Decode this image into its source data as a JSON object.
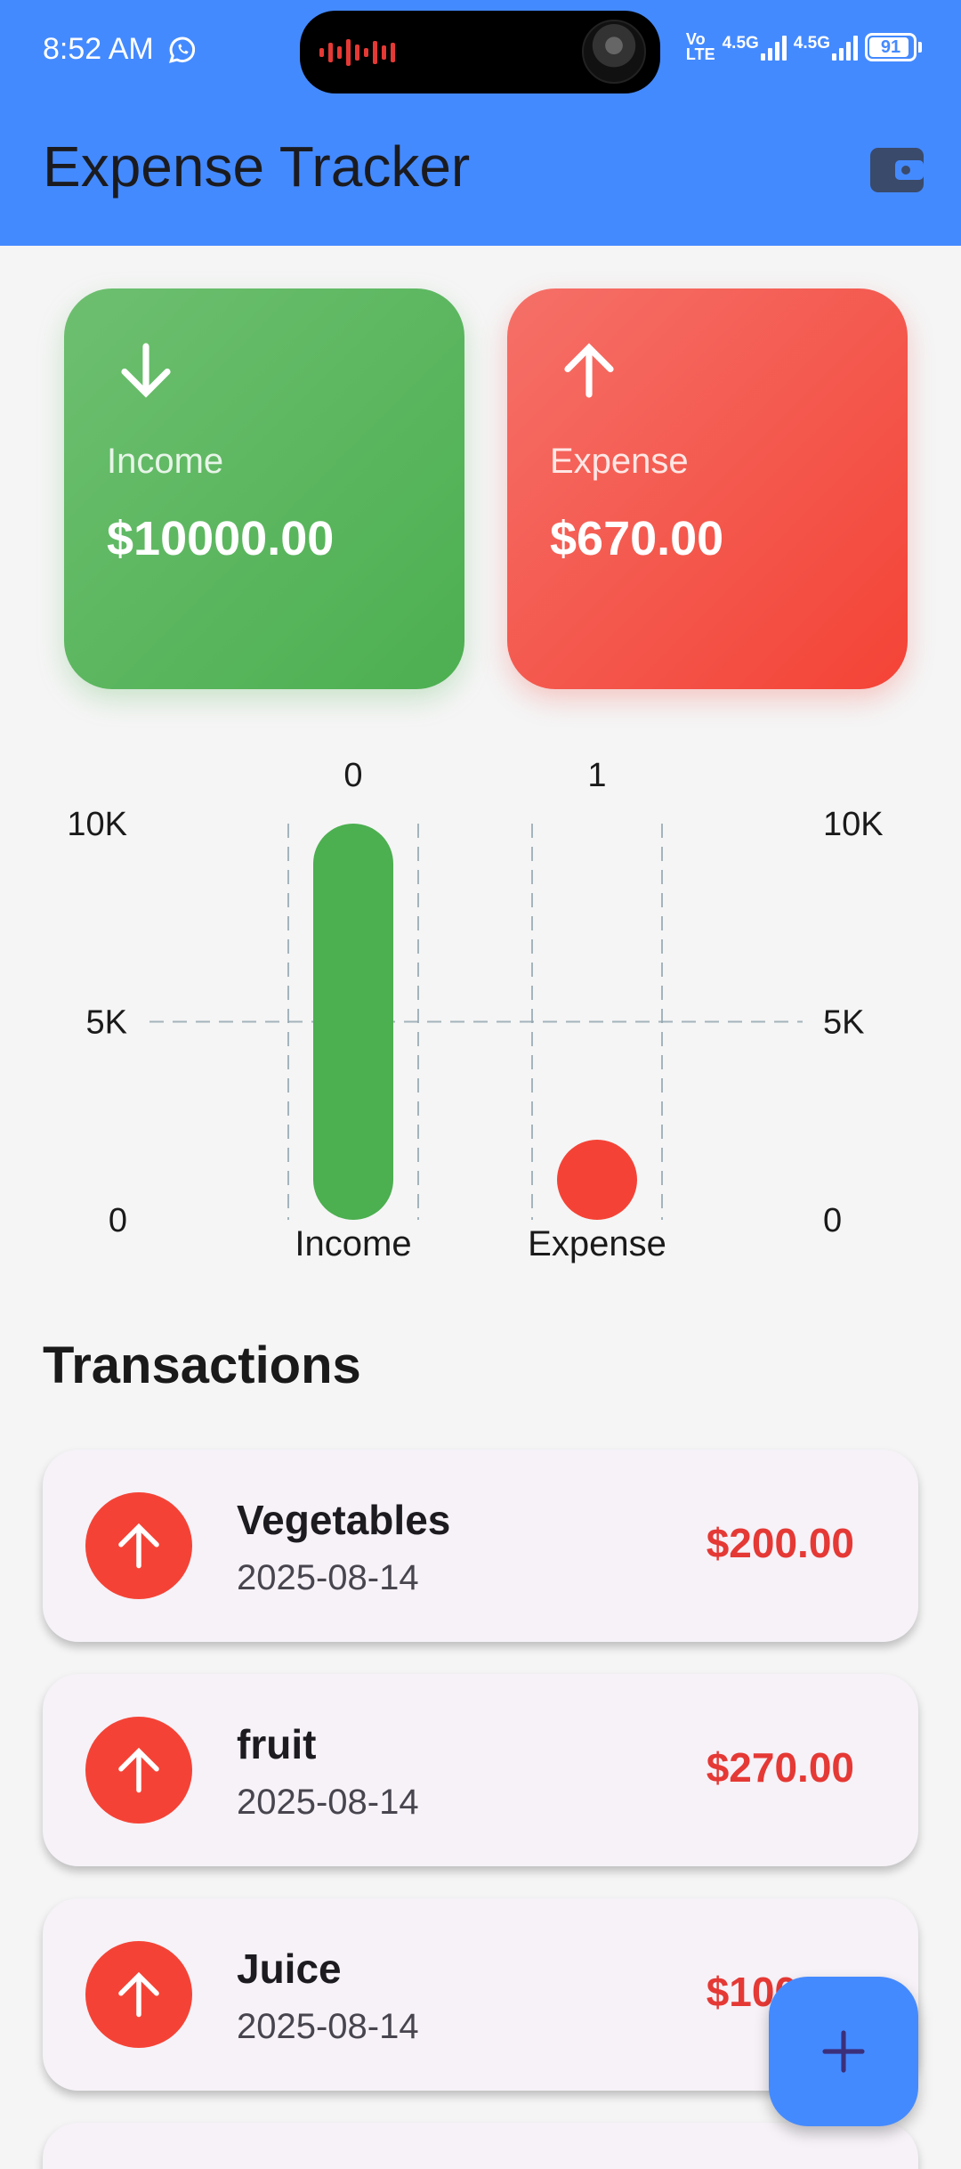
{
  "status_bar": {
    "time": "8:52 AM",
    "volte_top": "Vo",
    "volte_bottom": "LTE",
    "network1": "4.5G",
    "network2": "4.5G",
    "battery": "91",
    "battery_level": 0.91
  },
  "app_bar": {
    "title": "Expense Tracker",
    "action_icon": "wallet-icon"
  },
  "summary": {
    "income": {
      "label": "Income",
      "amount": "$10000.00",
      "icon": "arrow-down-icon",
      "color": "#4caf50"
    },
    "expense": {
      "label": "Expense",
      "amount": "$670.00",
      "icon": "arrow-up-icon",
      "color": "#f44336"
    }
  },
  "chart_data": {
    "type": "bar",
    "categories": [
      "Income",
      "Expense"
    ],
    "top_labels": [
      "0",
      "1"
    ],
    "values": [
      10000,
      670
    ],
    "colors": [
      "#4caf50",
      "#f44336"
    ],
    "ylim": [
      0,
      10000
    ],
    "yticks": [
      0,
      5000,
      10000
    ],
    "ytick_labels": [
      "0",
      "5K",
      "10K"
    ],
    "grid": true,
    "grid_style": "dashed"
  },
  "transactions": {
    "title": "Transactions",
    "items": [
      {
        "title": "Vegetables",
        "date": "2025-08-14",
        "amount": "$200.00"
      },
      {
        "title": "fruit",
        "date": "2025-08-14",
        "amount": "$270.00"
      },
      {
        "title": "Juice",
        "date": "2025-08-14",
        "amount": "$100.00"
      }
    ]
  },
  "fab": {
    "icon": "plus-icon"
  }
}
